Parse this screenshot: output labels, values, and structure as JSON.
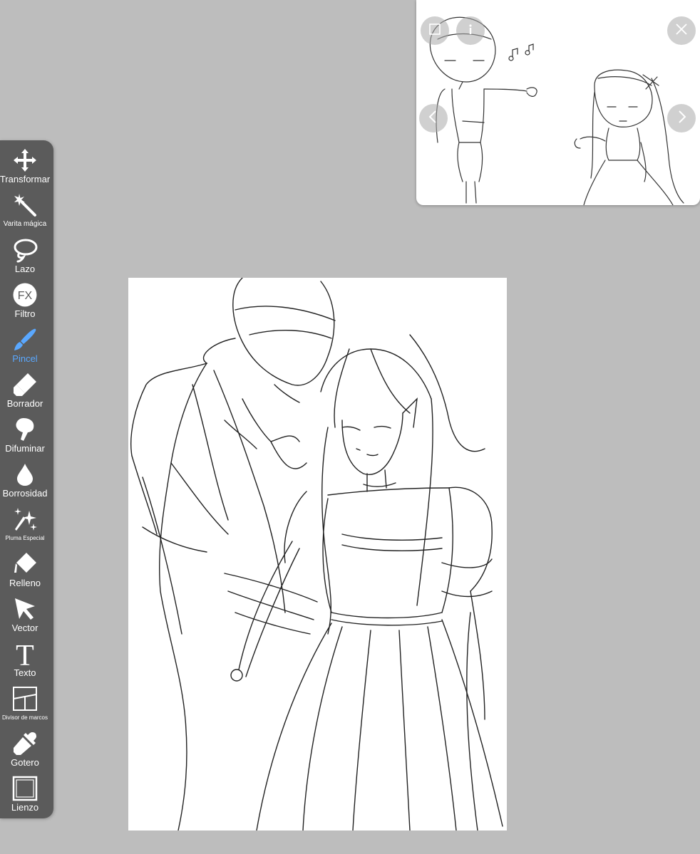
{
  "app": {
    "toolbar": {
      "tools": [
        {
          "id": "transform",
          "label": "Transformar",
          "icon": "move-arrows-icon"
        },
        {
          "id": "magic-wand",
          "label": "Varita mágica",
          "icon": "magic-wand-icon"
        },
        {
          "id": "lasso",
          "label": "Lazo",
          "icon": "lasso-icon"
        },
        {
          "id": "filter",
          "label": "Filtro",
          "icon": "fx-icon",
          "icon_text": "FX"
        },
        {
          "id": "brush",
          "label": "Pincel",
          "icon": "brush-icon",
          "active": true
        },
        {
          "id": "eraser",
          "label": "Borrador",
          "icon": "eraser-icon"
        },
        {
          "id": "smudge",
          "label": "Difuminar",
          "icon": "smudge-icon"
        },
        {
          "id": "blur",
          "label": "Borrosidad",
          "icon": "drop-icon"
        },
        {
          "id": "special-pen",
          "label": "Pluma Especial",
          "icon": "sparkle-pen-icon"
        },
        {
          "id": "fill",
          "label": "Relleno",
          "icon": "fill-bucket-icon"
        },
        {
          "id": "vector",
          "label": "Vector",
          "icon": "cursor-arrow-icon"
        },
        {
          "id": "text",
          "label": "Texto",
          "icon": "text-t-icon",
          "icon_text": "T"
        },
        {
          "id": "frame-divider",
          "label": "Divisor de marcos",
          "icon": "frame-divider-icon"
        },
        {
          "id": "eyedropper",
          "label": "Gotero",
          "icon": "eyedropper-icon"
        },
        {
          "id": "canvas",
          "label": "Lienzo",
          "icon": "canvas-icon"
        }
      ]
    },
    "reference_window": {
      "buttons": [
        "square-icon",
        "info-icon",
        "close-icon",
        "chevron-left-icon",
        "chevron-right-icon"
      ]
    },
    "colors": {
      "background": "#bdbdbd",
      "toolbar": "#5b5b5b",
      "active_tool": "#5aa8ff"
    }
  }
}
